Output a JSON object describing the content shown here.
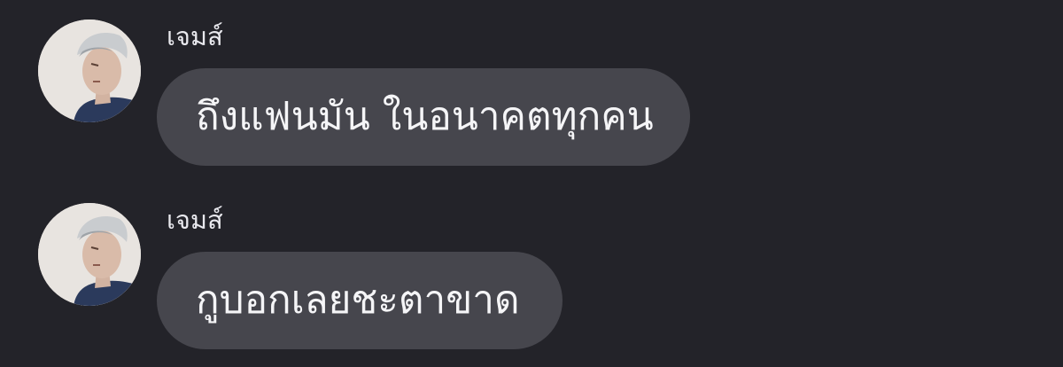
{
  "colors": {
    "background": "#232329",
    "bubble": "#46464d",
    "text": "#f5f5f7",
    "sender_name": "#e9e9ee"
  },
  "messages": [
    {
      "sender": "เจมส์",
      "avatar_icon": "profile-photo-avatar",
      "text": "ถึงแฟนมัน ในอนาคตทุกคน"
    },
    {
      "sender": "เจมส์",
      "avatar_icon": "profile-photo-avatar",
      "text": "กูบอกเลยชะตาขาด"
    }
  ]
}
